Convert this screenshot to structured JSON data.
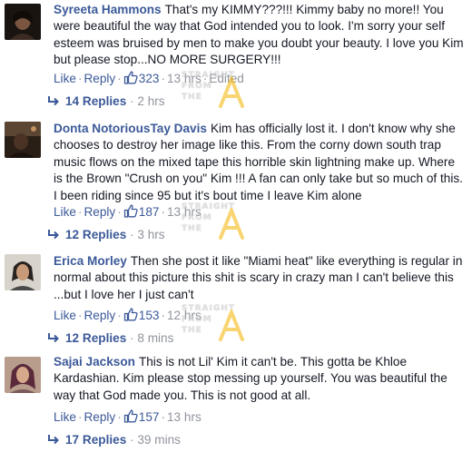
{
  "comments": [
    {
      "author": "Syreeta Hammons",
      "text": "That's my KIMMY???!!! Kimmy baby no more!! You were beautiful the way that God intended you to look. I'm sorry your self esteem was bruised by men to make you doubt your beauty. I love you Kim but please stop...NO MORE SURGERY!!!",
      "like": "Like",
      "reply": "Reply",
      "likes": "323",
      "time": "13 hrs",
      "edited": "Edited",
      "replies": "14 Replies",
      "replies_time": "2 hrs"
    },
    {
      "author": "Donta NotoriousTay Davis",
      "text": "Kim has officially lost it. I don't know why she chooses to destroy her image like this. From the corny down south trap music flows on the mixed tape this horrible skin lightning make up. Where is the Brown \"Crush on you\" Kim !!! A fan can only take but so much of this. I been riding since 95 but it's bout time I leave Kim alone",
      "like": "Like",
      "reply": "Reply",
      "likes": "187",
      "time": "13 hrs",
      "replies": "12 Replies",
      "replies_time": "3 hrs"
    },
    {
      "author": "Erica Morley",
      "text": "Then she post it like \"Miami heat\" like everything is regular in normal about this picture this shit is scary in crazy man I can't believe this ...but I love her I just can't",
      "like": "Like",
      "reply": "Reply",
      "likes": "153",
      "time": "12 hrs",
      "replies": "12 Replies",
      "replies_time": "8 mins"
    },
    {
      "author": "Sajai Jackson",
      "text": "This is not Lil' Kim it can't be. This gotta be Khloe Kardashian. Kim please stop messing up yourself. You was beautiful the way that God made you. This is not good at all.",
      "like": "Like",
      "reply": "Reply",
      "likes": "157",
      "time": "13 hrs",
      "replies": "17 Replies",
      "replies_time": "39 mins"
    }
  ],
  "watermark": {
    "line1": "STRAIGHT",
    "line2": "FROM",
    "line3": "THE",
    "letter": "A"
  },
  "colors": {
    "link": "#3b5998",
    "meta": "#90949c",
    "text": "#141823",
    "watermark_letter": "#f5b400"
  }
}
